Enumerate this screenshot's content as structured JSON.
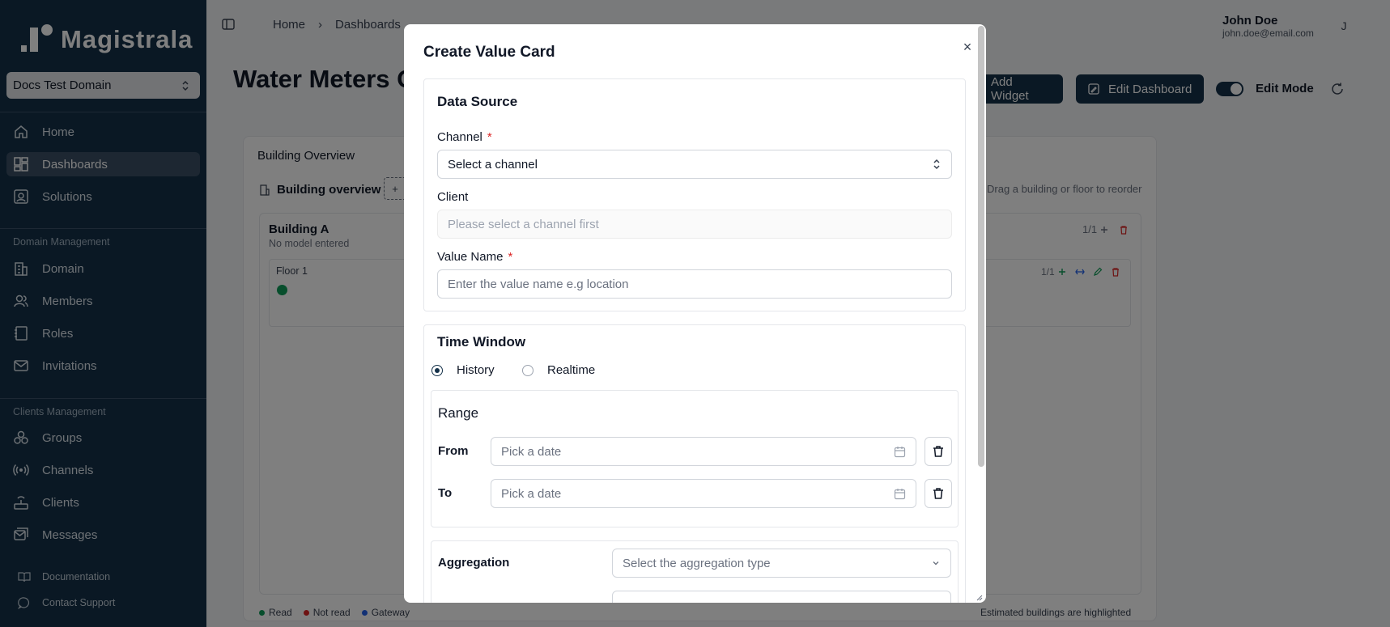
{
  "sidebar": {
    "logo": "Magistrala",
    "domain": "Docs Test Domain",
    "primary": [
      {
        "label": "Home",
        "icon": "home-icon"
      },
      {
        "label": "Dashboards",
        "icon": "dashboard-icon"
      },
      {
        "label": "Solutions",
        "icon": "solutions-icon"
      }
    ],
    "domain_section": "Domain Management",
    "domain_items": [
      {
        "label": "Domain",
        "icon": "building-icon"
      },
      {
        "label": "Members",
        "icon": "users-icon"
      },
      {
        "label": "Roles",
        "icon": "book-icon"
      },
      {
        "label": "Invitations",
        "icon": "mail-icon"
      }
    ],
    "clients_section": "Clients Management",
    "clients_items": [
      {
        "label": "Groups",
        "icon": "groups-icon"
      },
      {
        "label": "Channels",
        "icon": "radio-icon"
      },
      {
        "label": "Clients",
        "icon": "router-icon"
      },
      {
        "label": "Messages",
        "icon": "messages-icon"
      }
    ],
    "footer": [
      {
        "label": "Documentation",
        "icon": "book-open-icon"
      },
      {
        "label": "Contact Support",
        "icon": "chat-icon"
      }
    ]
  },
  "topbar": {
    "crumbs": [
      "Home",
      "Dashboards"
    ],
    "user_name": "John Doe",
    "user_email": "john.doe@email.com",
    "avatar_initial": "J"
  },
  "page": {
    "title": "Water Meters O",
    "add_widget": "Add Widget",
    "edit_dashboard": "Edit Dashboard",
    "edit_mode": "Edit Mode",
    "panel_title": "Building Overview",
    "tab_label": "Building overview",
    "tab_add": "+",
    "drag_hint": "Drag a building or floor to reorder",
    "building_name": "Building A",
    "building_sub": "No model entered",
    "building_counter": "1/1",
    "floor_name": "Floor 1",
    "floor_counter": "1/1",
    "legend": [
      {
        "label": "Read",
        "color": "#0f9d58"
      },
      {
        "label": "Not read",
        "color": "#dc2626"
      },
      {
        "label": "Gateway",
        "color": "#2563eb"
      }
    ],
    "est_hint": "Estimated buildings are highlighted"
  },
  "modal": {
    "title": "Create Value Card",
    "close": "×",
    "data_source": {
      "title": "Data Source",
      "channel_label": "Channel",
      "channel_value": "Select a channel",
      "client_label": "Client",
      "client_placeholder": "Please select a channel first",
      "value_label": "Value Name",
      "value_placeholder": "Enter the value name e.g location",
      "required_mark": "*"
    },
    "time_window": {
      "title": "Time Window",
      "history": "History",
      "realtime": "Realtime",
      "range_title": "Range",
      "from_label": "From",
      "to_label": "To",
      "date_placeholder": "Pick a date",
      "aggregation_label": "Aggregation",
      "aggregation_placeholder": "Select the aggregation type"
    }
  }
}
